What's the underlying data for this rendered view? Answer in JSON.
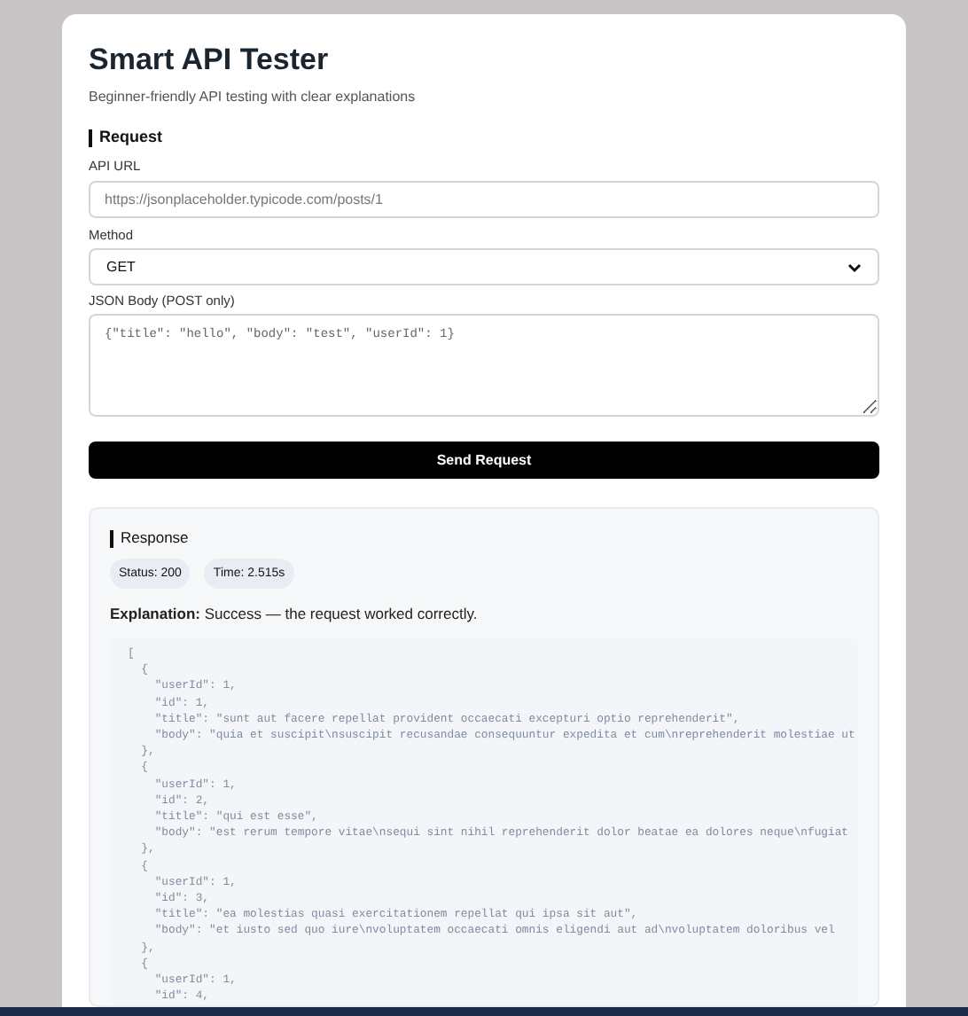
{
  "header": {
    "title": "Smart API Tester",
    "subtitle": "Beginner-friendly API testing with clear explanations"
  },
  "request": {
    "heading": "Request",
    "url": {
      "label": "API URL",
      "placeholder": "https://jsonplaceholder.typicode.com/posts/1"
    },
    "method": {
      "label": "Method",
      "value": "GET"
    },
    "body": {
      "label": "JSON Body (POST only)",
      "placeholder": "{\"title\": \"hello\", \"body\": \"test\", \"userId\": 1}"
    },
    "send_button": "Send Request"
  },
  "response": {
    "heading": "Response",
    "badges": [
      "Status: 200",
      "Time: 2.515s"
    ],
    "explanation": "**Explanation:** Success — the request worked correctly.",
    "body_lines": [
      "[",
      "  {",
      "    \"userId\": 1,",
      "    \"id\": 1,",
      "    \"title\": \"sunt aut facere repellat provident occaecati excepturi optio reprehenderit\",",
      "    \"body\": \"quia et suscipit\\nsuscipit recusandae consequuntur expedita et cum\\nreprehenderit molestiae ut",
      "  },",
      "  {",
      "    \"userId\": 1,",
      "    \"id\": 2,",
      "    \"title\": \"qui est esse\",",
      "    \"body\": \"est rerum tempore vitae\\nsequi sint nihil reprehenderit dolor beatae ea dolores neque\\nfugiat",
      "  },",
      "  {",
      "    \"userId\": 1,",
      "    \"id\": 3,",
      "    \"title\": \"ea molestias quasi exercitationem repellat qui ipsa sit aut\",",
      "    \"body\": \"et iusto sed quo iure\\nvoluptatem occaecati omnis eligendi aut ad\\nvoluptatem doloribus vel",
      "  },",
      "  {",
      "    \"userId\": 1,",
      "    \"id\": 4,"
    ]
  }
}
